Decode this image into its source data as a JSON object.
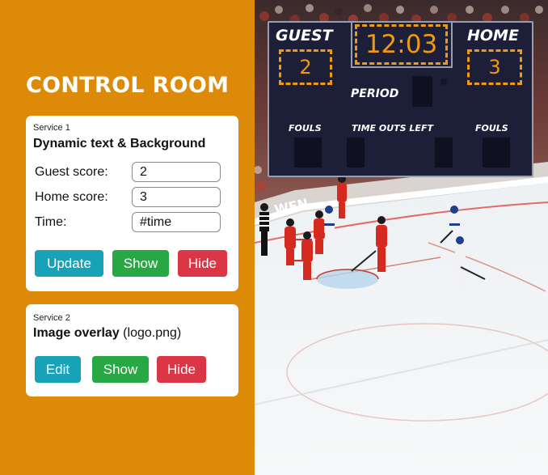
{
  "panel": {
    "title": "CONTROL ROOM"
  },
  "service1": {
    "caption": "Service 1",
    "title": "Dynamic text & Background",
    "fields": [
      {
        "label": "Guest score:",
        "value": "2"
      },
      {
        "label": "Home score:",
        "value": "3"
      },
      {
        "label": "Time:",
        "value": "#time"
      }
    ],
    "buttons": {
      "update": "Update",
      "show": "Show",
      "hide": "Hide"
    }
  },
  "service2": {
    "caption": "Service 2",
    "title_bold": "Image overlay",
    "title_rest": " (logo.png)",
    "buttons": {
      "edit": "Edit",
      "show": "Show",
      "hide": "Hide"
    }
  },
  "scoreboard": {
    "guest_label": "GUEST",
    "home_label": "HOME",
    "time": "12:03",
    "guest_score": "2",
    "home_score": "3",
    "period_label": "PERIOD",
    "fouls_left_label": "FOULS",
    "timeouts_label": "TIME OUTS LEFT",
    "fouls_right_label": "FOULS"
  },
  "video": {
    "arena_board_text": "WEN"
  },
  "colors": {
    "panel_bg": "#dc8a08",
    "accent_cyan": "#17a2b8",
    "accent_green": "#28a745",
    "accent_red": "#dc3545",
    "scoreboard_bg": "#1d1f38",
    "scoreboard_digits": "#f09a12",
    "team_red": "#d42a1f",
    "team_white": "#f2f2f5"
  }
}
